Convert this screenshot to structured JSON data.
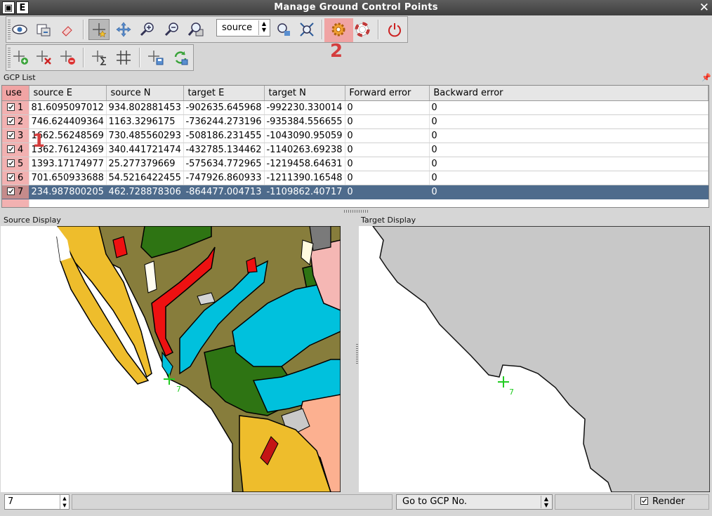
{
  "window": {
    "title": "Manage Ground Control Points",
    "menu_button_label": "E",
    "close_label": "✕"
  },
  "toolbar": {
    "source_select_value": "source"
  },
  "annotations": {
    "marker_1": "1",
    "marker_2": "2"
  },
  "gcp_list": {
    "title": "GCP List",
    "columns": [
      "use",
      "source E",
      "source N",
      "target E",
      "target N",
      "Forward error",
      "Backward error"
    ],
    "rows": [
      {
        "id": "1",
        "enabled": true,
        "source_e": "81.6095097012",
        "source_n": "934.802881453",
        "target_e": "-902635.645968",
        "target_n": "-992230.330014",
        "forward_error": "0",
        "backward_error": "0"
      },
      {
        "id": "2",
        "enabled": true,
        "source_e": "746.624409364",
        "source_n": "1163.3296175",
        "target_e": "-736244.273196",
        "target_n": "-935384.556655",
        "forward_error": "0",
        "backward_error": "0"
      },
      {
        "id": "3",
        "enabled": true,
        "source_e": "1662.56248569",
        "source_n": "730.485560293",
        "target_e": "-508186.231455",
        "target_n": "-1043090.95059",
        "forward_error": "0",
        "backward_error": "0"
      },
      {
        "id": "4",
        "enabled": true,
        "source_e": "1362.76124369",
        "source_n": "340.441721474",
        "target_e": "-432785.134462",
        "target_n": "-1140263.69238",
        "forward_error": "0",
        "backward_error": "0"
      },
      {
        "id": "5",
        "enabled": true,
        "source_e": "1393.17174977",
        "source_n": "25.277379669",
        "target_e": "-575634.772965",
        "target_n": "-1219458.64631",
        "forward_error": "0",
        "backward_error": "0"
      },
      {
        "id": "6",
        "enabled": true,
        "source_e": "701.650933688",
        "source_n": "54.5216422455",
        "target_e": "-747926.860933",
        "target_n": "-1211390.16548",
        "forward_error": "0",
        "backward_error": "0"
      },
      {
        "id": "7",
        "enabled": true,
        "source_e": "234.987800205",
        "source_n": "462.728878306",
        "target_e": "-864477.004713",
        "target_n": "-1109862.40717",
        "forward_error": "0",
        "backward_error": "0",
        "selected": true
      }
    ]
  },
  "source_display": {
    "title": "Source Display",
    "gcp_marker_label": "7"
  },
  "target_display": {
    "title": "Target Display",
    "gcp_marker_label": "7"
  },
  "statusbar": {
    "gcp_number_value": "7",
    "goto_select_value": "Go to GCP No.",
    "render_label": "Render",
    "render_checked": true
  },
  "colors": {
    "selection": "#4e6b8c",
    "annotation": "#d43d3d",
    "annotation_highlight": "#f0a4a4",
    "gcp_marker": "#22cc22"
  }
}
